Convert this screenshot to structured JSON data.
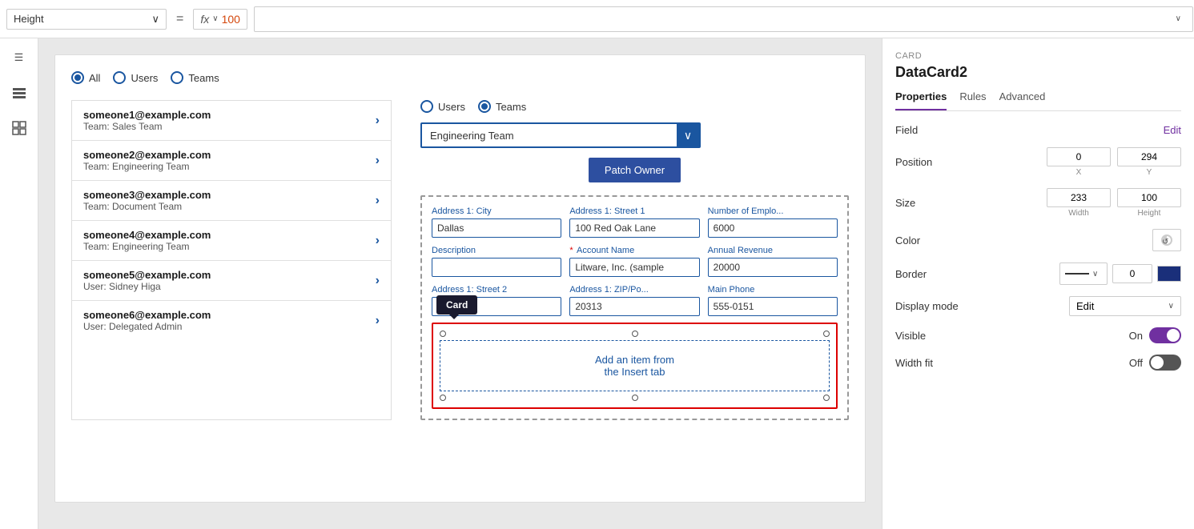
{
  "topBar": {
    "heightLabel": "Height",
    "equalsSign": "=",
    "fxLabel": "fx",
    "fxValue": "100",
    "chevron": "∨"
  },
  "sidebarIcons": [
    {
      "name": "hamburger-icon",
      "glyph": "☰"
    },
    {
      "name": "layers-icon",
      "glyph": "⊞"
    },
    {
      "name": "grid-icon",
      "glyph": "⊟"
    }
  ],
  "canvas": {
    "radioGroup": {
      "options": [
        "All",
        "Users",
        "Teams"
      ],
      "selected": "All"
    },
    "userList": [
      {
        "email": "someone1@example.com",
        "team": "Team: Sales Team"
      },
      {
        "email": "someone2@example.com",
        "team": "Team: Engineering Team"
      },
      {
        "email": "someone3@example.com",
        "team": "Team: Document Team"
      },
      {
        "email": "someone4@example.com",
        "team": "Team: Engineering Team"
      },
      {
        "email": "someone5@example.com",
        "team": "User: Sidney Higa"
      },
      {
        "email": "someone6@example.com",
        "team": "User: Delegated Admin"
      }
    ],
    "teamsPanel": {
      "radioOptions": [
        "Users",
        "Teams"
      ],
      "selectedRadio": "Teams",
      "dropdownValue": "Engineering Team",
      "patchButtonLabel": "Patch Owner",
      "cardTooltip": "Card",
      "formFields": [
        {
          "label": "Address 1: City",
          "value": "Dallas",
          "required": false
        },
        {
          "label": "Address 1: Street 1",
          "value": "100 Red Oak Lane",
          "required": false
        },
        {
          "label": "Number of Emplo...",
          "value": "6000",
          "required": false
        },
        {
          "label": "Description",
          "value": "",
          "required": false
        },
        {
          "label": "Account Name",
          "value": "Litware, Inc. (sample",
          "required": true
        },
        {
          "label": "Annual Revenue",
          "value": "20000",
          "required": false
        },
        {
          "label": "Address 1: Street 2",
          "value": "",
          "required": false
        },
        {
          "label": "Address 1: ZIP/Po...",
          "value": "20313",
          "required": false
        },
        {
          "label": "Main Phone",
          "value": "555-0151",
          "required": false
        }
      ],
      "cardPlaceholder": "Add an item from\nthe Insert tab"
    }
  },
  "properties": {
    "cardLabel": "CARD",
    "cardTitle": "DataCard2",
    "tabs": [
      "Properties",
      "Rules",
      "Advanced"
    ],
    "activeTab": "Properties",
    "fieldLabel": "Field",
    "editLabel": "Edit",
    "positionLabel": "Position",
    "positionX": "0",
    "positionY": "294",
    "positionXLabel": "X",
    "positionYLabel": "Y",
    "sizeLabel": "Size",
    "sizeWidth": "233",
    "sizeHeight": "100",
    "sizeWidthLabel": "Width",
    "sizeHeightLabel": "Height",
    "colorLabel": "Color",
    "borderLabel": "Border",
    "borderValue": "0",
    "displayModeLabel": "Display mode",
    "displayModeValue": "Edit",
    "visibleLabel": "Visible",
    "visibleOnLabel": "On",
    "widthFitLabel": "Width fit",
    "widthFitOffLabel": "Off"
  }
}
